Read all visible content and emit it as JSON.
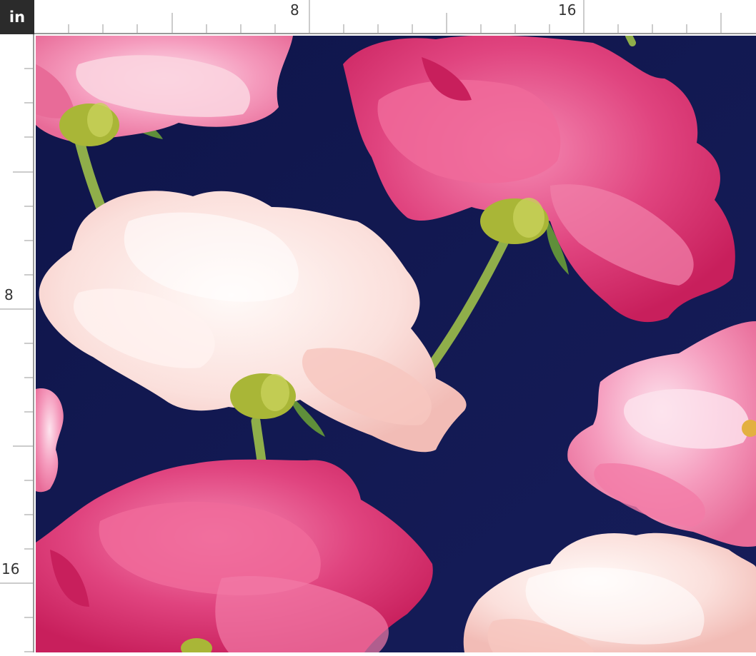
{
  "ruler": {
    "unit": "in",
    "top_labels": [
      "8",
      "16"
    ],
    "left_labels": [
      "8",
      "16"
    ]
  },
  "pattern": {
    "background_color": "#12184f",
    "motif": "peonies",
    "colors": {
      "deep_pink": "#e0326f",
      "pink": "#f27aa6",
      "blush": "#f8d2cf",
      "cream": "#fde8e4",
      "stem": "#8fae4a",
      "bud": "#a9b637"
    }
  }
}
